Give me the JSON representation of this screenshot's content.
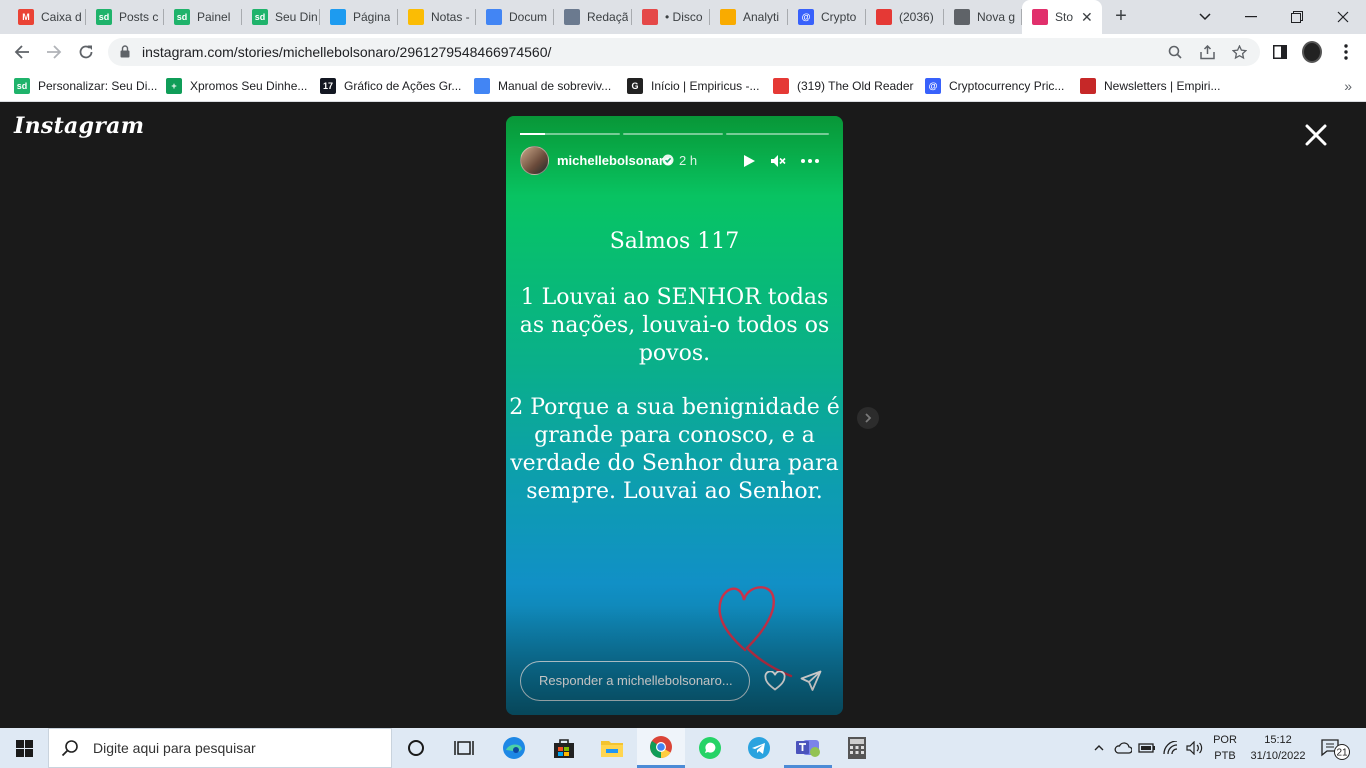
{
  "browser": {
    "tabs": [
      {
        "label": "Caixa d",
        "favicon": "gmail-icon",
        "color": "#ea4335",
        "glyph": "M"
      },
      {
        "label": "Posts c",
        "favicon": "sd-icon",
        "color": "#1fb36b",
        "glyph": "sd"
      },
      {
        "label": "Painel",
        "favicon": "sd-icon",
        "color": "#1fb36b",
        "glyph": "sd"
      },
      {
        "label": "Seu Din",
        "favicon": "sd-icon",
        "color": "#1fb36b",
        "glyph": "sd"
      },
      {
        "label": "Página",
        "favicon": "twitter-icon",
        "color": "#1d9bf0",
        "glyph": ""
      },
      {
        "label": "Notas -",
        "favicon": "drive-icon",
        "color": "#fbbc04",
        "glyph": ""
      },
      {
        "label": "Docum",
        "favicon": "docs-icon",
        "color": "#4285f4",
        "glyph": ""
      },
      {
        "label": "Redaçã",
        "favicon": "trello-icon",
        "color": "#6b7a8f",
        "glyph": ""
      },
      {
        "label": "• Disco",
        "favicon": "discord-icon",
        "color": "#e54848",
        "glyph": ""
      },
      {
        "label": "Analyti",
        "favicon": "analytics-icon",
        "color": "#f9ab00",
        "glyph": ""
      },
      {
        "label": "Crypto",
        "favicon": "coinmarketcap-icon",
        "color": "#3861fb",
        "glyph": "@"
      },
      {
        "label": "(2036)",
        "favicon": "oldreader-icon",
        "color": "#e53935",
        "glyph": ""
      },
      {
        "label": "Nova g",
        "favicon": "chrome-icon",
        "color": "#5f6368",
        "glyph": ""
      },
      {
        "label": "Sto",
        "favicon": "instagram-icon",
        "color": "#e1306c",
        "glyph": ""
      }
    ],
    "url": "instagram.com/stories/michellebolsonaro/2961279548466974560/",
    "bookmarks": [
      {
        "label": "Personalizar: Seu Di...",
        "favicon": "sd-icon",
        "color": "#1fb36b",
        "glyph": "sd"
      },
      {
        "label": "Xpromos Seu Dinhe...",
        "favicon": "sheets-icon",
        "color": "#0f9d58",
        "glyph": "+"
      },
      {
        "label": "Gráfico de Ações Gr...",
        "favicon": "tradingview-icon",
        "color": "#131722",
        "glyph": "17"
      },
      {
        "label": "Manual de sobreviv...",
        "favicon": "docs-icon",
        "color": "#4285f4",
        "glyph": ""
      },
      {
        "label": "Início | Empiricus -...",
        "favicon": "empiricus-icon",
        "color": "#222222",
        "glyph": "G"
      },
      {
        "label": "(319) The Old Reader",
        "favicon": "oldreader-icon",
        "color": "#e53935",
        "glyph": ""
      },
      {
        "label": "Cryptocurrency Pric...",
        "favicon": "coinmarketcap-icon",
        "color": "#3861fb",
        "glyph": "@"
      },
      {
        "label": "Newsletters | Empiri...",
        "favicon": "empiricus-drop-icon",
        "color": "#c62828",
        "glyph": ""
      }
    ]
  },
  "instagram": {
    "logo": "Instagram",
    "story": {
      "username": "michellebolsonaro",
      "time": "2 h",
      "progress_segments": 3,
      "progress_current_fraction": 0.25,
      "title": "Salmos 117",
      "verse1": [
        "1 Louvai ao SENHOR todas",
        "as nações, louvai-o todos os",
        "povos."
      ],
      "verse2": [
        "2 Porque a sua benignidade é",
        "grande para conosco, e a",
        "verdade do Senhor dura para",
        "sempre. Louvai ao Senhor."
      ],
      "reply_placeholder": "Responder a michellebolsonaro..."
    }
  },
  "taskbar": {
    "search_placeholder": "Digite aqui para pesquisar",
    "lang_top": "POR",
    "lang_bottom": "PTB",
    "time": "15:12",
    "date": "31/10/2022",
    "notification_count": "21"
  }
}
